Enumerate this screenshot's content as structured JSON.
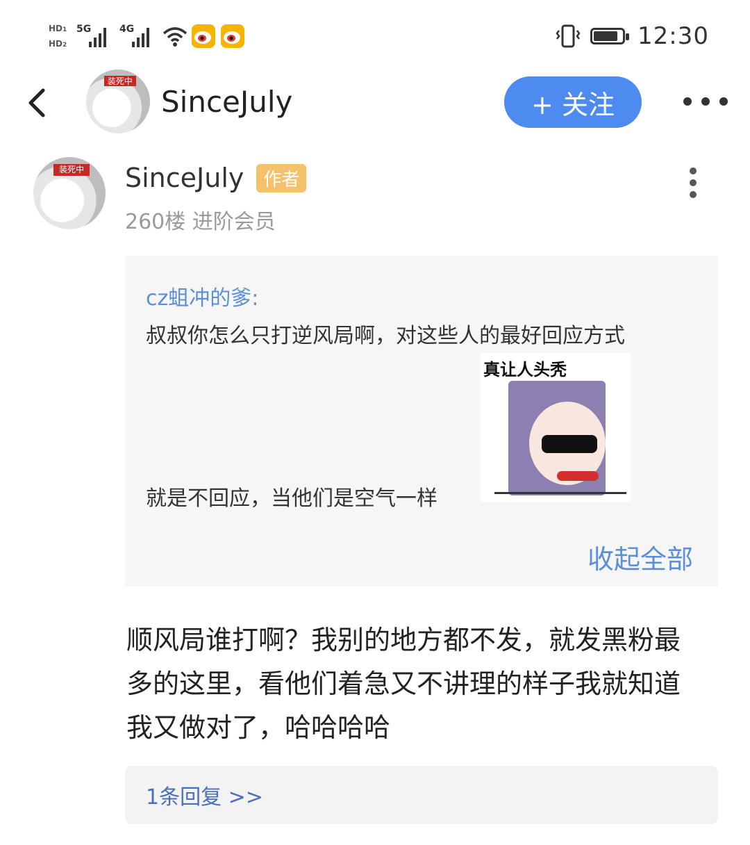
{
  "status_bar": {
    "hd1": "HD",
    "sub1": "1",
    "hd2": "HD",
    "sub2": "2",
    "net1": "5G",
    "net2": "4G",
    "time": "12:30",
    "icons": [
      "wifi-icon",
      "weibo-icon",
      "weibo-icon",
      "vibrate-icon",
      "battery-icon"
    ]
  },
  "header": {
    "back_icon": "chevron-left-icon",
    "avatar_banner": "装死中",
    "username": "SinceJuly",
    "follow_label": "+ 关注",
    "more_icon": "more-horizontal-icon",
    "follow_color": "#4d8bf0"
  },
  "post": {
    "avatar_banner": "装死中",
    "author": "SinceJuly",
    "author_badge": "作者",
    "meta": "260楼 进阶会员",
    "more_icon": "more-vertical-icon",
    "quote": {
      "name": "cz蛆冲的爹:",
      "line1": "叔叔你怎么只打逆风局啊，对这些人的最好回应方式",
      "line2": "就是不回应，当他们是空气一样",
      "sticker_caption": "真让人头秃",
      "collapse_label": "收起全部"
    },
    "reply_lines": [
      "顺风局谁打啊？我别的地方都不发，就发黑粉最",
      "多的这里，看他们着急又不讲理的样子我就知道",
      "我又做对了，哈哈哈哈"
    ],
    "replies_label": "1条回复 >>"
  }
}
